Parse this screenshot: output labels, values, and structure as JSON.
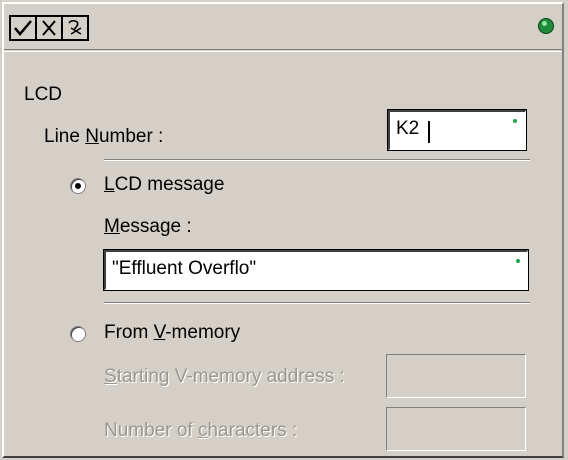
{
  "toolbar": {
    "ok_icon": "checkmark-icon",
    "cancel_icon": "x-icon",
    "help_icon": "help-icon",
    "status_color": "#1f8a3a"
  },
  "section_title": "LCD",
  "line_number": {
    "label": "Line Number :",
    "value": "K2"
  },
  "lcd_message": {
    "option_label": "LCD message",
    "selected": true,
    "message_label": "Message :",
    "message_value": "\"Effluent Overflo\""
  },
  "vmemory": {
    "option_label": "From V-memory",
    "selected": false,
    "start_label": "Starting V-memory address :",
    "start_value": "",
    "count_label": "Number of characters :",
    "count_value": ""
  }
}
